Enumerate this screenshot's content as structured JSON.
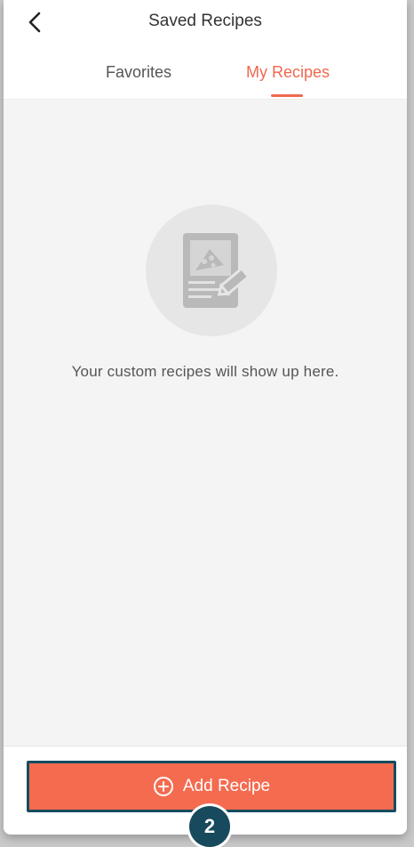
{
  "header": {
    "title": "Saved Recipes",
    "back_icon": "chevron-left-icon"
  },
  "tabs": [
    {
      "label": "Favorites",
      "active": false
    },
    {
      "label": "My Recipes",
      "active": true
    }
  ],
  "empty_state": {
    "illustration_icon": "recipe-card-edit-icon",
    "message": "Your custom recipes will show up here."
  },
  "footer": {
    "add_button_label": "Add Recipe",
    "add_button_icon": "plus-circle-icon"
  },
  "annotation": {
    "step_number": "2"
  },
  "colors": {
    "accent": "#f0684e",
    "button_bg": "#f46b50",
    "highlight_border": "#164c5f",
    "badge_bg": "#174a5c"
  }
}
